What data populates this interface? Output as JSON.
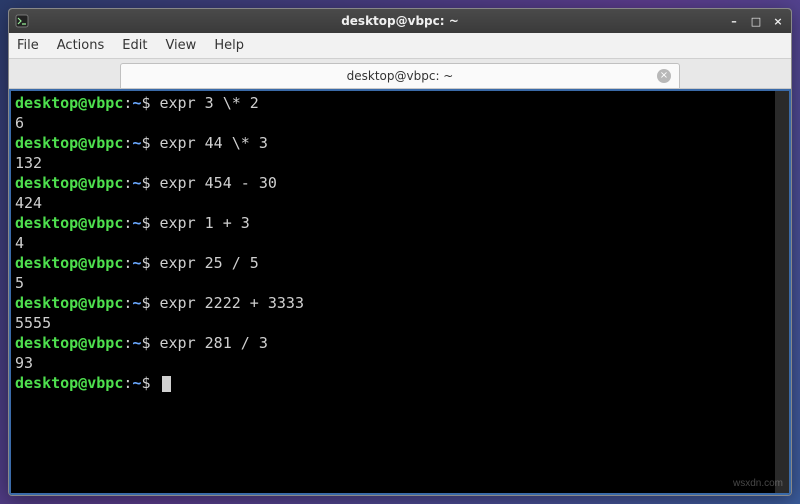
{
  "window": {
    "title": "desktop@vbpc: ~",
    "controls": {
      "min": "–",
      "max": "□",
      "close": "×"
    }
  },
  "menu": {
    "file": "File",
    "actions": "Actions",
    "edit": "Edit",
    "view": "View",
    "help": "Help"
  },
  "tab": {
    "label": "desktop@vbpc: ~",
    "close": "×"
  },
  "prompt": {
    "user": "desktop@vbpc",
    "sep": ":",
    "path": "~",
    "symbol": "$"
  },
  "session": [
    {
      "cmd": "expr 3 \\* 2",
      "out": "6"
    },
    {
      "cmd": "expr 44 \\* 3",
      "out": "132"
    },
    {
      "cmd": "expr 454 - 30",
      "out": "424"
    },
    {
      "cmd": "expr 1 + 3",
      "out": "4"
    },
    {
      "cmd": "expr 25 / 5",
      "out": "5"
    },
    {
      "cmd": "expr 2222 + 3333",
      "out": "5555"
    },
    {
      "cmd": "expr 281 / 3",
      "out": "93"
    }
  ],
  "watermark": "wsxdn.com"
}
